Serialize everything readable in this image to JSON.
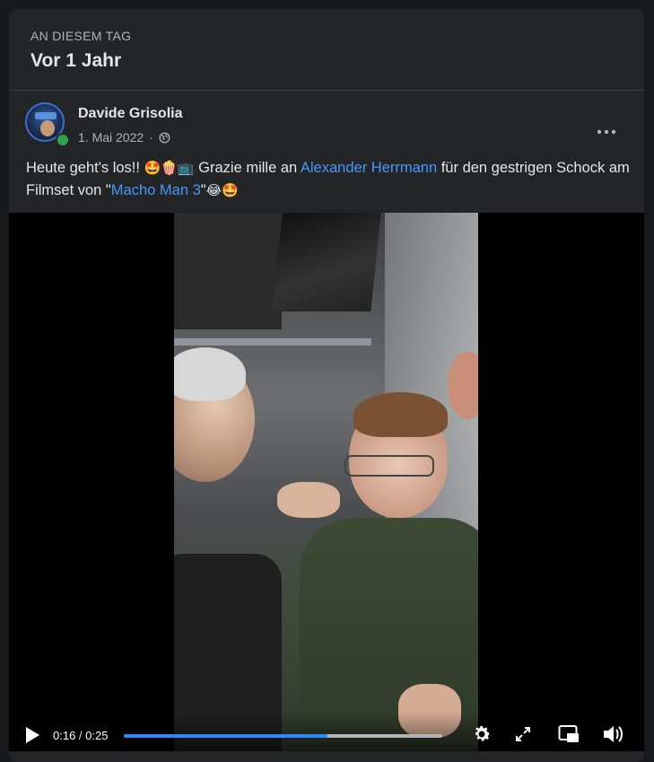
{
  "memory": {
    "eyebrow": "AN DIESEM TAG",
    "headline": "Vor 1 Jahr"
  },
  "post": {
    "author": "Davide Grisolia",
    "date": "1. Mai 2022",
    "separator": "·",
    "privacy_icon": "globe-icon",
    "more_icon": "more-options-icon",
    "text": {
      "part1": "Heute geht's los!! ",
      "emojis1": "🤩🍿📺",
      "part2": " Grazie mille an ",
      "link1": "Alexander Herrmann",
      "part3": " für den gestrigen Schock am Filmset von \"",
      "link2": "Macho Man 3",
      "part4": "\"",
      "emojis2": "😂🤩"
    }
  },
  "video": {
    "current_time": "0:16",
    "time_separator": " / ",
    "duration": "0:25",
    "progress_fraction": 0.64,
    "controls": [
      "play-icon",
      "settings-icon",
      "fullscreen-icon",
      "picture-in-picture-icon",
      "volume-icon"
    ]
  },
  "colors": {
    "background": "#18191a",
    "card": "#242526",
    "link": "#4599ff",
    "progress": "#2d88ff",
    "online": "#31a24c"
  }
}
